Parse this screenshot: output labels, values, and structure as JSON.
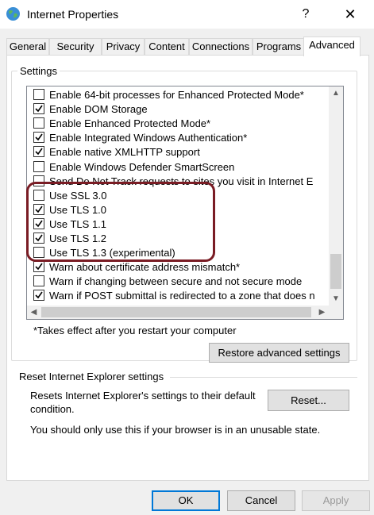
{
  "window": {
    "title": "Internet Properties",
    "help_glyph": "?",
    "close_glyph": "✕"
  },
  "tabs": [
    {
      "label": "General"
    },
    {
      "label": "Security"
    },
    {
      "label": "Privacy"
    },
    {
      "label": "Content"
    },
    {
      "label": "Connections"
    },
    {
      "label": "Programs"
    },
    {
      "label": "Advanced",
      "active": true
    }
  ],
  "settings": {
    "group_label": "Settings",
    "items": [
      {
        "label": "Enable 64-bit processes for Enhanced Protected Mode*",
        "checked": false
      },
      {
        "label": "Enable DOM Storage",
        "checked": true
      },
      {
        "label": "Enable Enhanced Protected Mode*",
        "checked": false
      },
      {
        "label": "Enable Integrated Windows Authentication*",
        "checked": true
      },
      {
        "label": "Enable native XMLHTTP support",
        "checked": true
      },
      {
        "label": "Enable Windows Defender SmartScreen",
        "checked": false
      },
      {
        "label": "Send Do Not Track requests to sites you visit in Internet E",
        "checked": false
      },
      {
        "label": "Use SSL 3.0",
        "checked": false
      },
      {
        "label": "Use TLS 1.0",
        "checked": true
      },
      {
        "label": "Use TLS 1.1",
        "checked": true
      },
      {
        "label": "Use TLS 1.2",
        "checked": true
      },
      {
        "label": "Use TLS 1.3 (experimental)",
        "checked": false
      },
      {
        "label": "Warn about certificate address mismatch*",
        "checked": true
      },
      {
        "label": "Warn if changing between secure and not secure mode",
        "checked": false
      },
      {
        "label": "Warn if POST submittal is redirected to a zone that does n",
        "checked": true
      }
    ],
    "note": "*Takes effect after you restart your computer",
    "restore_button": "Restore advanced settings"
  },
  "reset": {
    "header": "Reset Internet Explorer settings",
    "description": "Resets Internet Explorer's settings to their default condition.",
    "button": "Reset...",
    "note": "You should only use this if your browser is in an unusable state."
  },
  "footer": {
    "ok": "OK",
    "cancel": "Cancel",
    "apply": "Apply"
  },
  "colors": {
    "accent": "#0078d7",
    "highlight_border": "#7a1c24"
  }
}
